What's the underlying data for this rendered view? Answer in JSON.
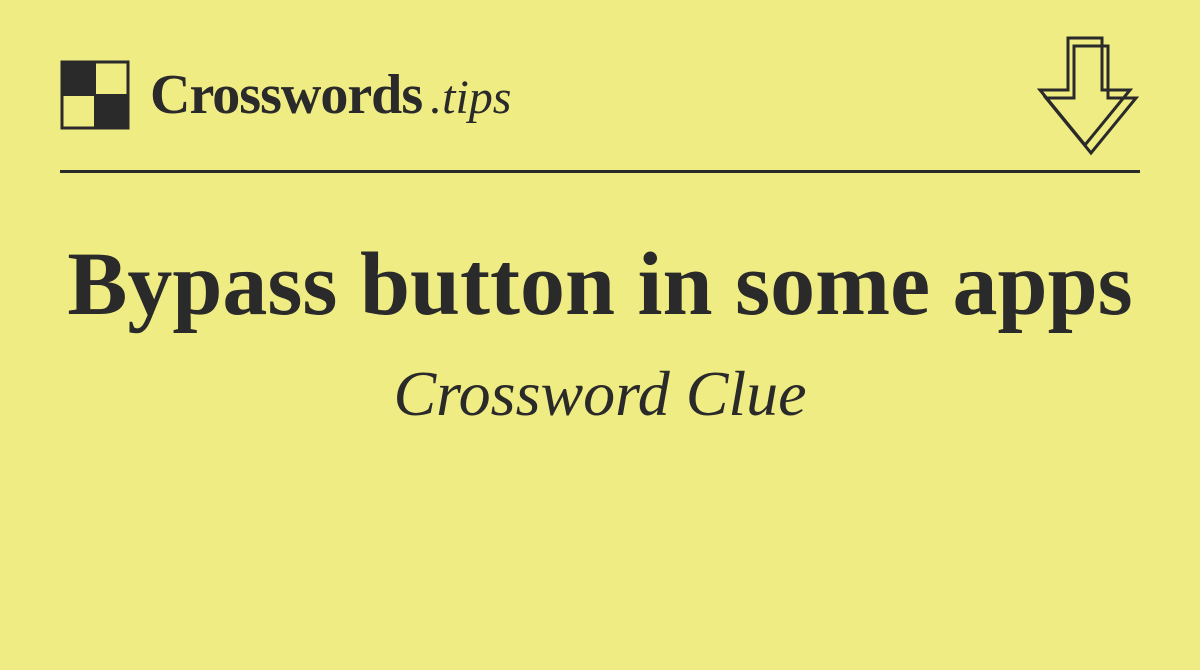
{
  "header": {
    "logo_main": "Crosswords",
    "logo_ext": ".tips"
  },
  "content": {
    "clue_title": "Bypass button in some apps",
    "subtitle": "Crossword Clue"
  }
}
